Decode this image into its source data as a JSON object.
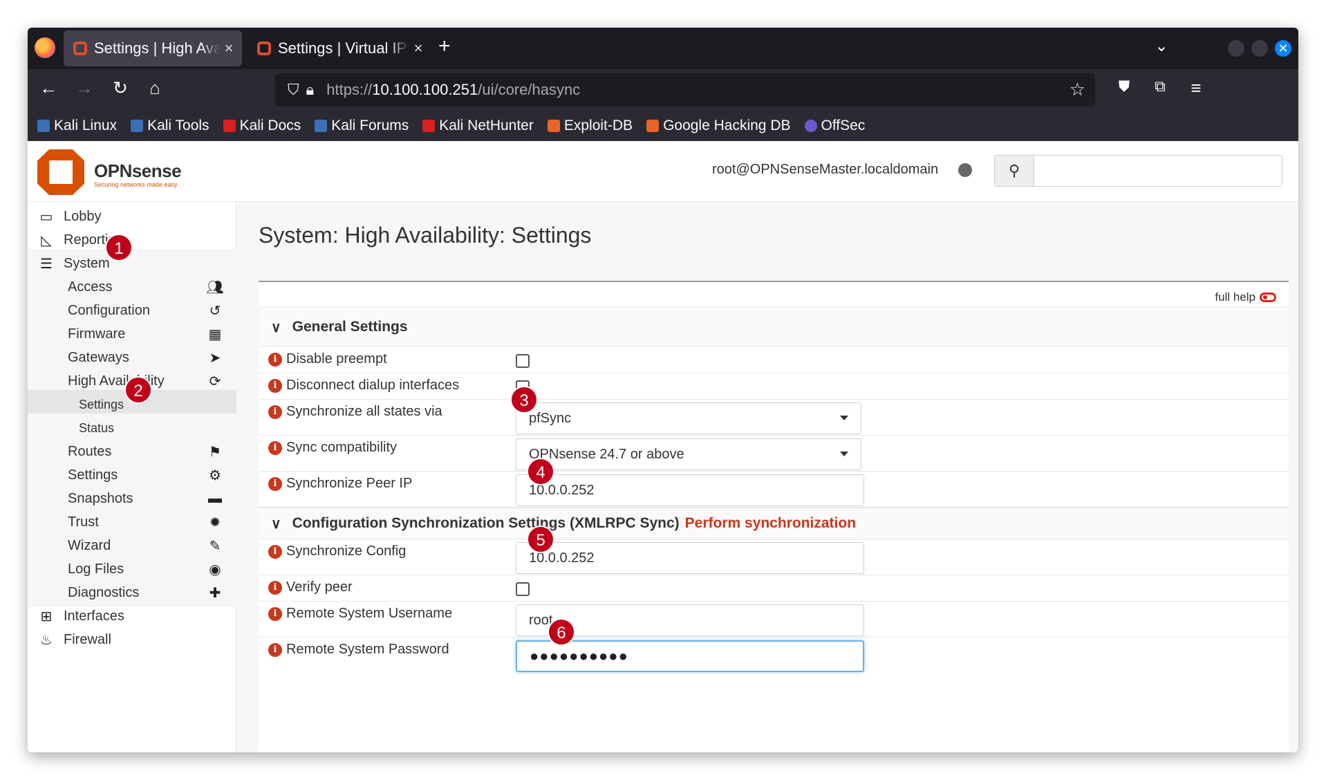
{
  "browser": {
    "tabs": [
      {
        "title": "Settings | High Availability",
        "active": true
      },
      {
        "title": "Settings | Virtual IPs | Inte",
        "active": false
      }
    ],
    "url_prefix": "https://",
    "url_host": "10.100.100.251",
    "url_path": "/ui/core/hasync",
    "bookmarks": [
      {
        "label": "Kali Linux",
        "color": "#3b6fb6"
      },
      {
        "label": "Kali Tools",
        "color": "#3b6fb6"
      },
      {
        "label": "Kali Docs",
        "color": "#d92020"
      },
      {
        "label": "Kali Forums",
        "color": "#3b6fb6"
      },
      {
        "label": "Kali NetHunter",
        "color": "#d92020"
      },
      {
        "label": "Exploit-DB",
        "color": "#e8642a"
      },
      {
        "label": "Google Hacking DB",
        "color": "#e8642a"
      },
      {
        "label": "OffSec",
        "color": "#6a5acd"
      }
    ]
  },
  "header": {
    "logo_text": "OPNsense",
    "logo_tagline": "Securing networks made easy",
    "user": "root@OPNSenseMaster.localdomain"
  },
  "sidebar": {
    "top_items": [
      {
        "label": "Lobby",
        "icon": "laptop-icon"
      },
      {
        "label": "Reporting",
        "icon": "area-chart-icon"
      },
      {
        "label": "System",
        "icon": "server-icon"
      }
    ],
    "system_items": [
      {
        "label": "Access",
        "icon": "users-icon"
      },
      {
        "label": "Configuration",
        "icon": "history-icon"
      },
      {
        "label": "Firmware",
        "icon": "building-icon"
      },
      {
        "label": "Gateways",
        "icon": "location-arrow-icon"
      },
      {
        "label": "High Availability",
        "icon": "refresh-icon"
      }
    ],
    "ha_items": [
      {
        "label": "Settings",
        "active": true
      },
      {
        "label": "Status",
        "active": false
      }
    ],
    "system_items_2": [
      {
        "label": "Routes",
        "icon": "signs-icon"
      },
      {
        "label": "Settings",
        "icon": "cogs-icon"
      },
      {
        "label": "Snapshots",
        "icon": "hdd-icon"
      },
      {
        "label": "Trust",
        "icon": "certificate-icon"
      },
      {
        "label": "Wizard",
        "icon": "magic-icon"
      },
      {
        "label": "Log Files",
        "icon": "eye-icon"
      },
      {
        "label": "Diagnostics",
        "icon": "medkit-icon"
      }
    ],
    "bottom_items": [
      {
        "label": "Interfaces",
        "icon": "sitemap-icon"
      },
      {
        "label": "Firewall",
        "icon": "fire-icon"
      }
    ]
  },
  "main": {
    "title": "System: High Availability: Settings",
    "full_help": "full help",
    "general_section": "General Settings",
    "disable_preempt": "Disable preempt",
    "disconnect_dialup": "Disconnect dialup interfaces",
    "sync_states_label": "Synchronize all states via",
    "sync_states_value": "pfSync",
    "sync_compat_label": "Sync compatibility",
    "sync_compat_value": "OPNsense 24.7 or above",
    "peer_ip_label": "Synchronize Peer IP",
    "peer_ip_value": "10.0.0.252",
    "config_section": "Configuration Synchronization Settings (XMLRPC Sync)",
    "perform_sync": "Perform synchronization",
    "sync_config_label": "Synchronize Config",
    "sync_config_value": "10.0.0.252",
    "verify_peer": "Verify peer",
    "remote_user_label": "Remote System Username",
    "remote_user_value": "root",
    "remote_pass_label": "Remote System Password",
    "remote_pass_value": "●●●●●●●●●●"
  },
  "badges": [
    "1",
    "2",
    "3",
    "4",
    "5",
    "6"
  ],
  "colors": {
    "accent": "#d94f00",
    "badge": "#c0001a",
    "link": "#c8381c"
  }
}
